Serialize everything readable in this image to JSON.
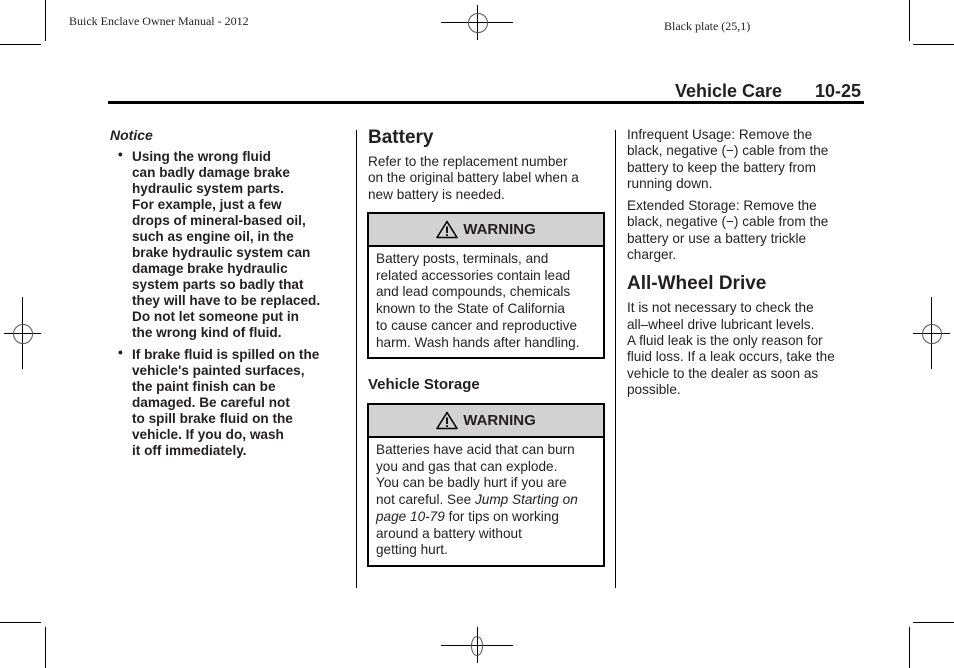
{
  "header": {
    "manual_title": "Buick Enclave Owner Manual - 2012",
    "plate": "Black plate (25,1)",
    "section": "Vehicle Care",
    "page_number": "10-25"
  },
  "left_column": {
    "notice_title": "Notice",
    "bullets": [
      {
        "lines": [
          "Using the wrong fluid",
          "can badly damage brake",
          "hydraulic system parts.",
          "For example, just a few",
          "drops of mineral-based oil,",
          "such as engine oil, in the",
          "brake hydraulic system can",
          "damage brake hydraulic",
          "system parts so badly that",
          "they will have to be replaced.",
          "Do not let someone put in",
          "the wrong kind of fluid."
        ]
      },
      {
        "lines": [
          "If brake fluid is spilled on the",
          "vehicle's painted surfaces,",
          "the paint finish can be",
          "damaged. Be careful not",
          "to spill brake fluid on the",
          "vehicle. If you do, wash",
          "it off immediately."
        ]
      }
    ]
  },
  "middle_column": {
    "battery_heading": "Battery",
    "battery_intro": [
      "Refer to the replacement number",
      "on the original battery label when a",
      "new battery is needed."
    ],
    "warning1": {
      "label": "WARNING",
      "icon": "warning-triangle-icon",
      "lines": [
        "Battery posts, terminals, and",
        "related accessories contain lead",
        "and lead compounds, chemicals",
        "known to the State of California",
        "to cause cancer and reproductive",
        "harm. Wash hands after handling."
      ]
    },
    "storage_heading": "Vehicle Storage",
    "warning2": {
      "label": "WARNING",
      "icon": "warning-triangle-icon",
      "line1": "Batteries have acid that can burn",
      "line2": "you and gas that can explode.",
      "line3": "You can be badly hurt if you are",
      "line4_pre": "not careful. See ",
      "line4_link": "Jump Starting on",
      "line5_link": "page 10-79",
      "line5_post": " for tips on working",
      "line6": "around a battery without",
      "line7": "getting hurt."
    }
  },
  "right_column": {
    "infrequent": [
      "Infrequent Usage: Remove the",
      "black, negative (−) cable from the",
      "battery to keep the battery from",
      "running down."
    ],
    "extended": [
      "Extended Storage: Remove the",
      "black, negative (−) cable from the",
      "battery or use a battery trickle",
      "charger."
    ],
    "awd_heading": "All-Wheel Drive",
    "awd_text": [
      "It is not necessary to check the",
      "all–wheel drive lubricant levels.",
      "A fluid leak is the only reason for",
      "fluid loss. If a leak occurs, take the",
      "vehicle to the dealer as soon as",
      "possible."
    ]
  }
}
